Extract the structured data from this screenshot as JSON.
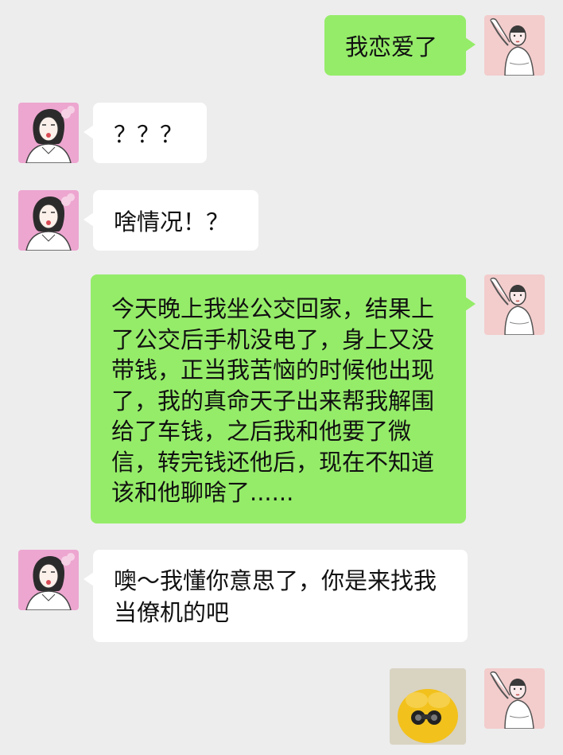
{
  "conversation": {
    "messages": [
      {
        "side": "right",
        "text": "我恋爱了"
      },
      {
        "side": "left",
        "text": "？？？"
      },
      {
        "side": "left",
        "text": "啥情况！？"
      },
      {
        "side": "right",
        "text": "今天晚上我坐公交回家，结果上了公交后手机没电了，身上又没带钱，正当我苦恼的时候他出现了，我的真命天子出来帮我解围给了车钱，之后我和他要了微信，转完钱还他后，现在不知道该和他聊啥了......"
      },
      {
        "side": "left",
        "text": "噢～我懂你意思了，你是来找我当僚机的吧"
      },
      {
        "side": "right",
        "type": "sticker",
        "icon": "duck-with-binoculars-sticker"
      }
    ]
  },
  "avatars": {
    "self": "woman-arm-raised-avatar",
    "friend": "woman-pink-background-avatar"
  },
  "colors": {
    "background": "#ededed",
    "self_bubble": "#95ec69",
    "friend_bubble": "#ffffff"
  }
}
